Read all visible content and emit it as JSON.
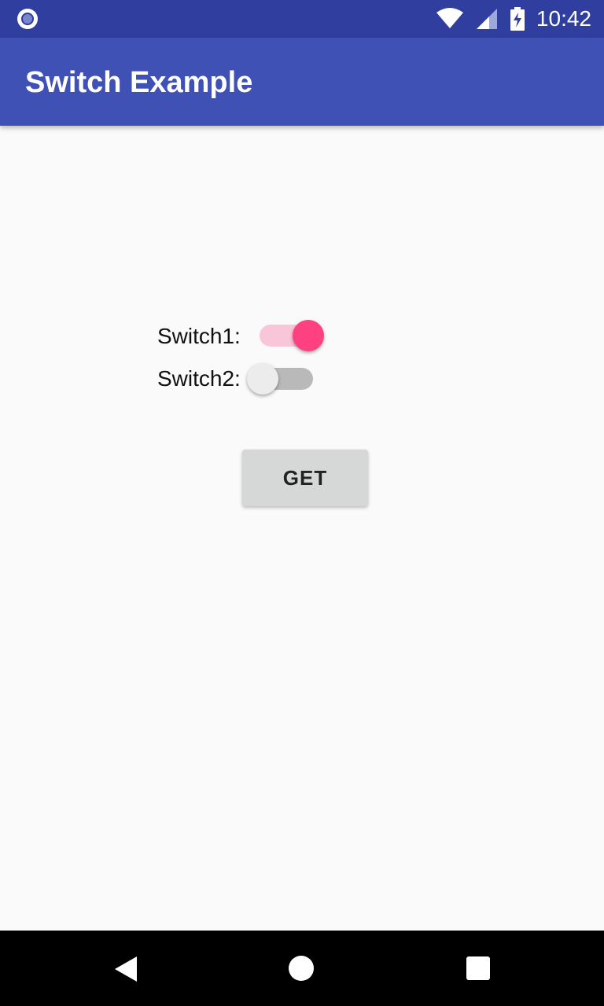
{
  "status_bar": {
    "time": "10:42",
    "icons": [
      "notification-circle-icon",
      "wifi-icon",
      "signal-icon",
      "battery-charging-icon"
    ]
  },
  "app_bar": {
    "title": "Switch Example"
  },
  "switches": [
    {
      "label": "Switch1:",
      "checked": true,
      "accent_color": "#ff4081",
      "track_color": "#f8c6d8"
    },
    {
      "label": "Switch2:",
      "checked": false,
      "thumb_color": "#ececec",
      "track_color": "#b9b9b9"
    }
  ],
  "button": {
    "label": "GET"
  },
  "nav_bar": {
    "icons": [
      "back-icon",
      "home-icon",
      "recents-icon"
    ]
  },
  "colors": {
    "primary": "#3f51b5",
    "primary_dark": "#303f9f",
    "background": "#fafafa"
  }
}
